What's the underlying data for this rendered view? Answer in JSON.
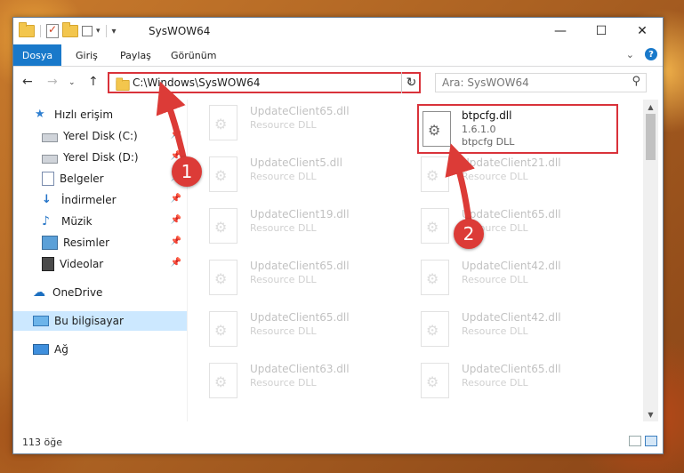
{
  "window": {
    "title": "SysWOW64"
  },
  "ribbon": {
    "file_tab": "Dosya",
    "tabs": [
      "Giriş",
      "Paylaş",
      "Görünüm"
    ]
  },
  "address": {
    "path": "C:\\Windows\\SysWOW64"
  },
  "search": {
    "placeholder": "Ara: SysWOW64"
  },
  "nav": {
    "quick_access": "Hızlı erişim",
    "items": [
      "Yerel Disk (C:)",
      "Yerel Disk (D:)",
      "Belgeler",
      "İndirmeler",
      "Müzik",
      "Resimler",
      "Videolar"
    ],
    "onedrive": "OneDrive",
    "this_pc": "Bu bilgisayar",
    "network": "Ağ"
  },
  "files_left": [
    {
      "name": "UpdateClient65.dll",
      "desc": "Resource DLL"
    },
    {
      "name": "UpdateClient5.dll",
      "desc": "Resource DLL"
    },
    {
      "name": "UpdateClient19.dll",
      "desc": "Resource DLL"
    },
    {
      "name": "UpdateClient65.dll",
      "desc": "Resource DLL"
    },
    {
      "name": "UpdateClient65.dll",
      "desc": "Resource DLL"
    },
    {
      "name": "UpdateClient63.dll",
      "desc": "Resource DLL"
    }
  ],
  "files_right": [
    {
      "name": "UpdateClient21.dll",
      "desc": "Resource DLL"
    },
    {
      "name": "UpdateClient65.dll",
      "desc": "Resource DLL"
    },
    {
      "name": "UpdateClient42.dll",
      "desc": "Resource DLL"
    },
    {
      "name": "UpdateClient42.dll",
      "desc": "Resource DLL"
    },
    {
      "name": "UpdateClient65.dll",
      "desc": "Resource DLL"
    }
  ],
  "highlighted_file": {
    "name": "btpcfg.dll",
    "version": "1.6.1.0",
    "desc": "btpcfg DLL"
  },
  "status": {
    "count": "113 öğe"
  },
  "annotations": {
    "step1": "1",
    "step2": "2"
  },
  "colors": {
    "accent": "#1979ca",
    "highlight": "#d9323a",
    "selected": "#cce8ff"
  }
}
